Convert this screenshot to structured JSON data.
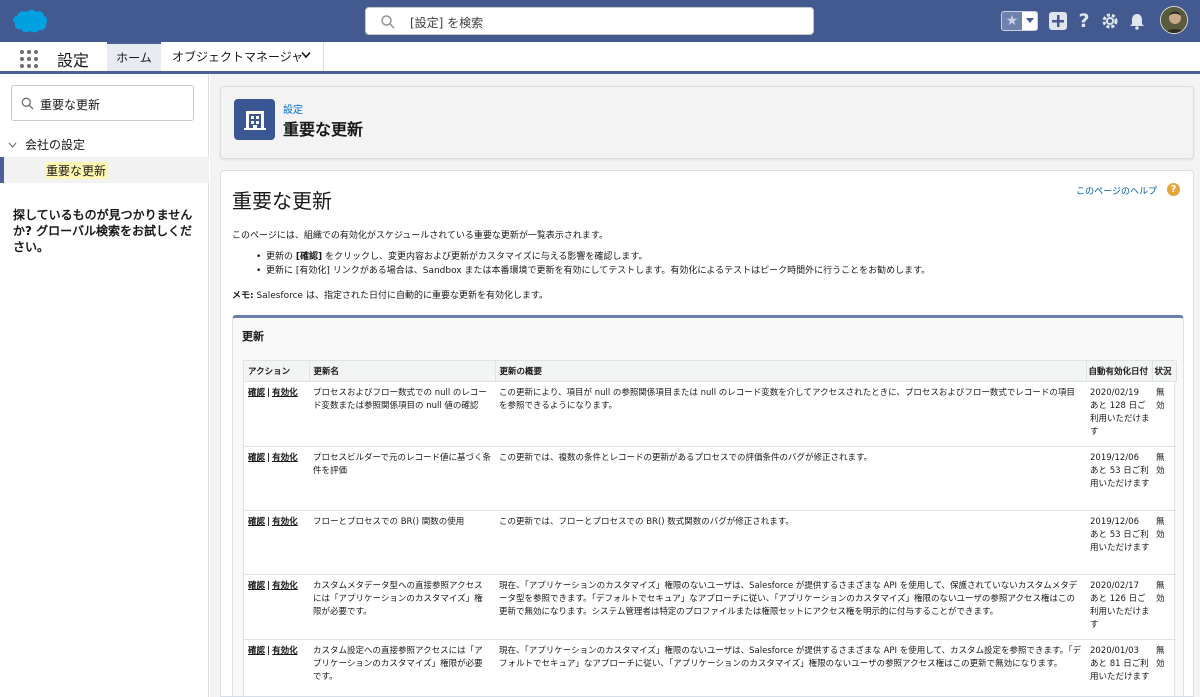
{
  "header": {
    "search_placeholder": "[設定] を検索"
  },
  "nav": {
    "app_name": "設定",
    "tabs": [
      {
        "label": "ホーム"
      },
      {
        "label": "オブジェクトマネージャ"
      }
    ]
  },
  "sidebar": {
    "quickfind_value": "重要な更新",
    "parent_label": "会社の設定",
    "child_label": "重要な更新",
    "help_text": "探しているものが見つかりませんか? グローバル検索をお試しください。"
  },
  "page_header": {
    "breadcrumb": "設定",
    "title": "重要な更新"
  },
  "content": {
    "title": "重要な更新",
    "help_link": "このページのヘルプ",
    "intro": "このページには、組織での有効化がスケジュールされている重要な更新が一覧表示されます。",
    "bullet1_pre": "更新の ",
    "bullet1_bold": "[確認]",
    "bullet1_post": " をクリックし、変更内容および更新がカスタマイズに与える影響を確認します。",
    "bullet2": "更新に [有効化] リンクがある場合は、Sandbox または本番環境で更新を有効にしてテストします。有効化によるテストはピーク時間外に行うことをお勧めします。",
    "memo_label": "メモ:",
    "memo_text": " Salesforce は、指定された日付に自動的に重要な更新を有効化します。"
  },
  "panel": {
    "title": "更新",
    "columns": {
      "action": "アクション",
      "name": "更新名",
      "summary": "更新の概要",
      "date": "自動有効化日付",
      "status": "状況"
    },
    "rows": [
      {
        "review": "確認",
        "enable": "有効化",
        "name": "プロセスおよびフロー数式での null のレコード変数または参照関係項目の null 値の確認",
        "summary": "この更新により、項目が null の参照関係項目または null のレコード変数を介してアクセスされたときに、プロセスおよびフロー数式でレコードの項目を参照できるようになります。",
        "date": "2020/02/19 あと 128 日ご利用いただけます",
        "status": "無効"
      },
      {
        "review": "確認",
        "enable": "有効化",
        "name": "プロセスビルダーで元のレコード値に基づく条件を評価",
        "summary": "この更新では、複数の条件とレコードの更新があるプロセスでの評価条件のバグが修正されます。",
        "date": "2019/12/06 あと 53 日ご利用いただけます",
        "status": "無効"
      },
      {
        "review": "確認",
        "enable": "有効化",
        "name": "フローとプロセスでの BR() 関数の使用",
        "summary": "この更新では、フローとプロセスでの BR() 数式関数のバグが修正されます。",
        "date": "2019/12/06 あと 53 日ご利用いただけます",
        "status": "無効"
      },
      {
        "review": "確認",
        "enable": "有効化",
        "name": "カスタムメタデータ型への直接参照アクセスには「アプリケーションのカスタマイズ」権限が必要です。",
        "summary": "現在、「アプリケーションのカスタマイズ」権限のないユーザは、Salesforce が提供するさまざまな API を使用して、保護されていないカスタムメタデータ型を参照できます。「デフォルトでセキュア」なアプローチに従い、「アプリケーションのカスタマイズ」権限のないユーザの参照アクセス権はこの更新で無効になります。システム管理者は特定のプロファイルまたは権限セットにアクセス権を明示的に付与することができます。",
        "date": "2020/02/17 あと 126 日ご利用いただけます",
        "status": "無効"
      },
      {
        "review": "確認",
        "enable": "有効化",
        "name": "カスタム設定への直接参照アクセスには「アプリケーションのカスタマイズ」権限が必要です。",
        "summary": "現在、「アプリケーションのカスタマイズ」権限のないユーザは、Salesforce が提供するさまざまな API を使用して、カスタム設定を参照できます。「デフォルトでセキュア」なアプローチに従い、「アプリケーションのカスタマイズ」権限のないユーザの参照アクセス権はこの更新で無効になります。",
        "date": "2020/01/03 あと 81 日ご利用いただけます",
        "status": "無効"
      }
    ]
  },
  "colors": {
    "header_bg": "#425a8f",
    "brand_blue": "#3a5794",
    "link_blue": "#0070d2",
    "help_orange": "#e7a43a"
  },
  "icons": [
    "salesforce-cloud-icon",
    "search-icon",
    "star-icon",
    "plus-icon",
    "question-icon",
    "gear-icon",
    "bell-icon",
    "waffle-icon",
    "chevron-down-icon",
    "building-icon"
  ]
}
